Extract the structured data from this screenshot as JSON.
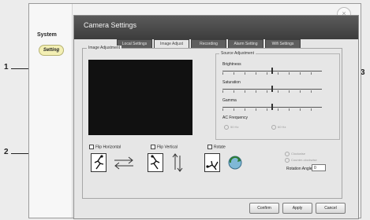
{
  "sidebar": {
    "title": "System",
    "active_item": "Setting"
  },
  "window": {
    "title": "Camera Settings",
    "close_glyph": "×",
    "tabs": [
      {
        "label": "Local Settings",
        "active": false
      },
      {
        "label": "Image Adjust",
        "active": true
      },
      {
        "label": "Recording",
        "active": false
      },
      {
        "label": "Alarm Setting",
        "active": false
      },
      {
        "label": "Wifi Settings",
        "active": false
      }
    ]
  },
  "image_adjust": {
    "group_label": "Image Adjustment",
    "source_group_label": "Source Adjustment",
    "sliders": [
      {
        "label": "Brightness",
        "value": 0.5
      },
      {
        "label": "Saturation",
        "value": 0.5
      },
      {
        "label": "Gamma",
        "value": 0.5
      }
    ],
    "ac_frequency": {
      "label": "AC Frequency",
      "options": [
        "50 Hz",
        "60 Hz"
      ]
    },
    "flip_horizontal": "Flip Horizontal",
    "flip_vertical": "Flip Vertical",
    "rotate": "Rotate",
    "rotate_options": [
      "Clockwise",
      "Counter-clockwise"
    ],
    "rotation_angle_label": "Rotation Angle",
    "rotation_angle_value": "0"
  },
  "buttons": {
    "confirm": "Confirm",
    "apply": "Apply",
    "cancel": "Cancel"
  },
  "callouts": {
    "c1": "1",
    "c2": "2",
    "c3": "3"
  },
  "colors": {
    "title_bar": "#4a4a4a",
    "preview_bg": "#111111",
    "pill": "#f3efb4"
  }
}
